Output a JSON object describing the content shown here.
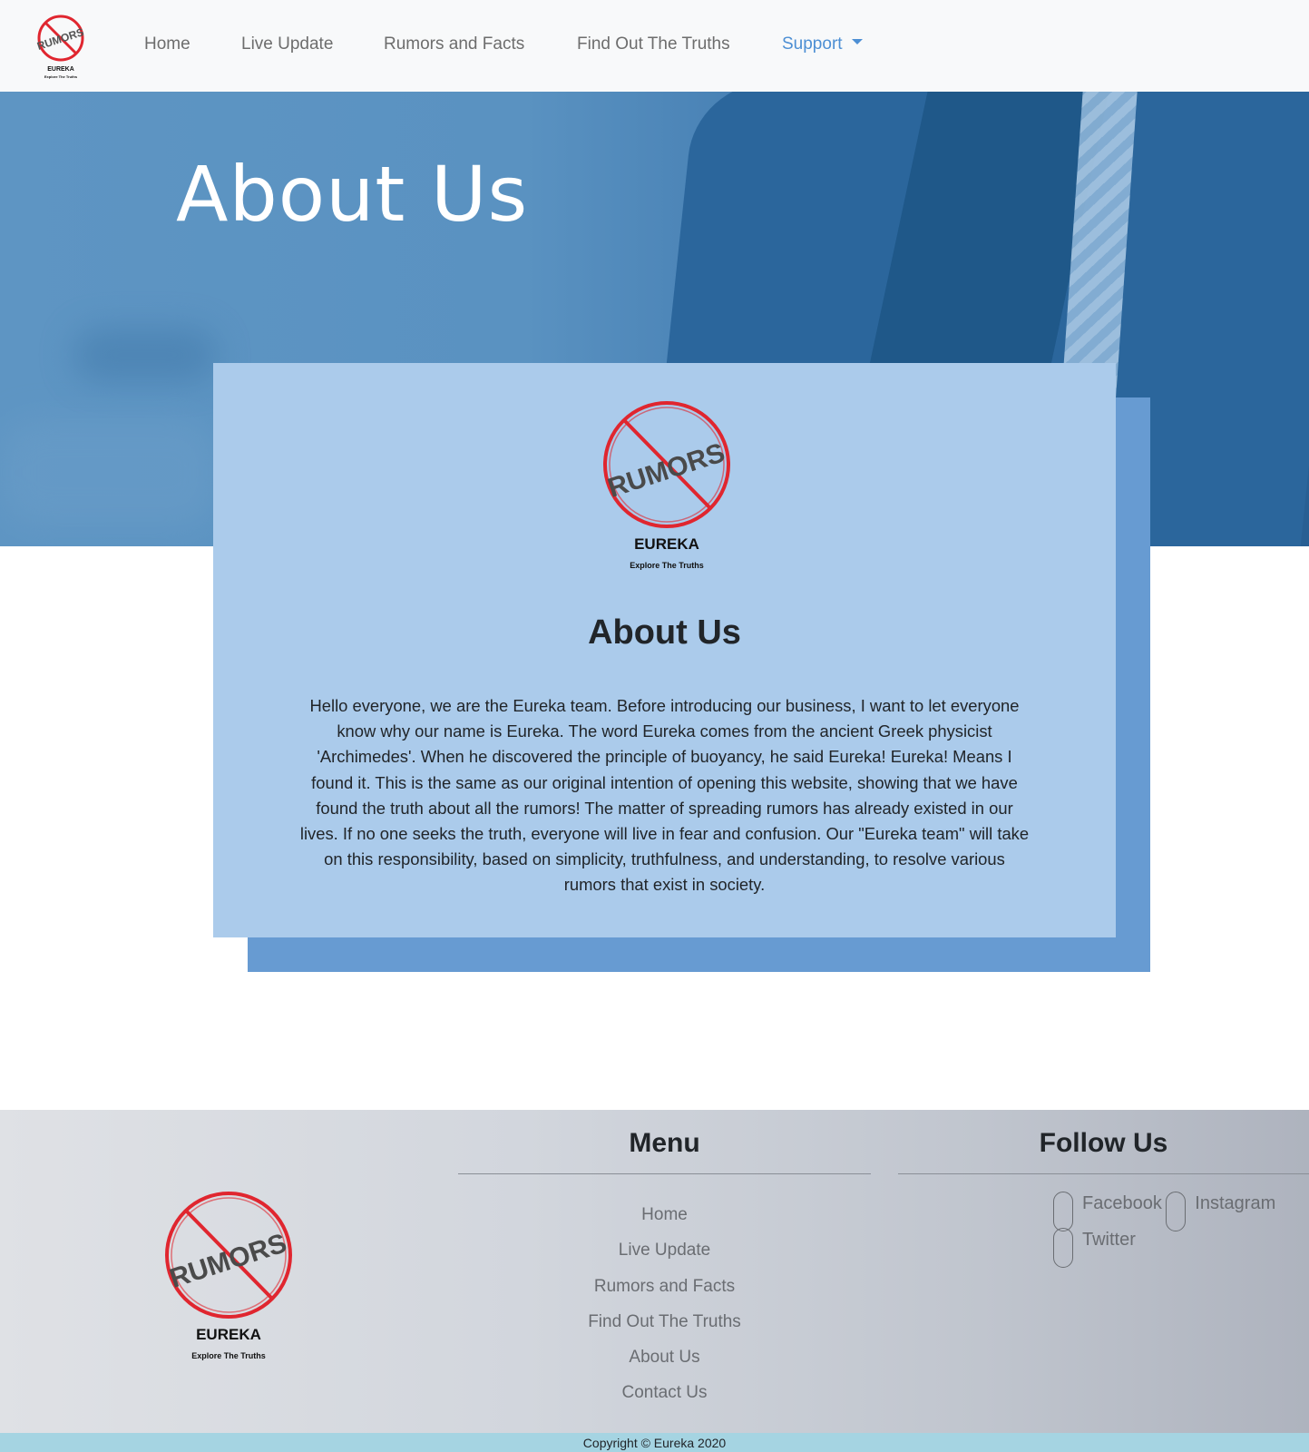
{
  "nav": {
    "logo": {
      "brand": "EUREKA",
      "tagline": "Explore The Truths",
      "stamp": "RUMORS"
    },
    "links": [
      "Home",
      "Live Update",
      "Rumors and Facts",
      "Find Out The Truths"
    ],
    "support_label": "Support"
  },
  "hero": {
    "title": "About Us"
  },
  "card": {
    "logo": {
      "brand": "EUREKA",
      "tagline": "Explore The Truths",
      "stamp": "RUMORS"
    },
    "title": "About Us",
    "text": "Hello everyone, we are the Eureka team. Before introducing our business, I want to let everyone know why our name is Eureka. The word Eureka comes from the ancient Greek physicist 'Archimedes'. When he discovered the principle of buoyancy, he said Eureka! Eureka! Means I found it. This is the same as our original intention of opening this website, showing that we have found the truth about all the rumors! The matter of spreading rumors has already existed in our lives. If no one seeks the truth, everyone will live in fear and confusion. Our \"Eureka team\" will take on this responsibility, based on simplicity, truthfulness, and understanding, to resolve various rumors that exist in society."
  },
  "footer": {
    "logo": {
      "brand": "EUREKA",
      "tagline": "Explore The Truths",
      "stamp": "RUMORS"
    },
    "menu_heading": "Menu",
    "menu_items": [
      "Home",
      "Live Update",
      "Rumors and Facts",
      "Find Out The Truths",
      "About Us",
      "Contact Us"
    ],
    "follow_heading": "Follow Us",
    "social": [
      "Facebook",
      "Instagram",
      "Twitter"
    ]
  },
  "copyright": "Copyright © Eureka 2020",
  "colors": {
    "accent": "#4d8fd4",
    "card": "#abcbeb",
    "card_shadow": "#679bd2",
    "copyright_bar": "#a5d4e2",
    "stamp_red": "#e0262f"
  }
}
